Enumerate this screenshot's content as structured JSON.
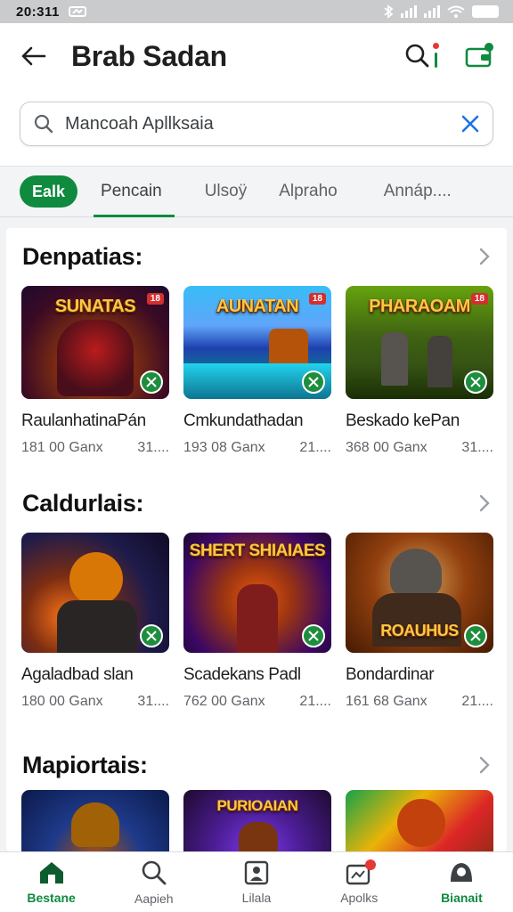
{
  "status_bar": {
    "time": "20:311"
  },
  "header": {
    "title": "Brab Sadan",
    "back_icon": "arrow-left-icon",
    "search_icon": "search-icon",
    "notification_icon": "wallet-icon"
  },
  "search": {
    "value": "Mancoah Apllksaia",
    "placeholder": "Mancoah Apllksaia"
  },
  "tabs": [
    {
      "label": "Ealk",
      "active": true
    },
    {
      "label": "Pencain",
      "active": false
    },
    {
      "label": "Ulsoÿ",
      "active": false
    },
    {
      "label": "Alpraho",
      "active": false
    },
    {
      "label": "Annáp....",
      "active": false
    }
  ],
  "sections": [
    {
      "title": "Denpatias:",
      "apps": [
        {
          "name": "RaulanhatinaPán",
          "downloads": "181 00 Ganx",
          "size": "31....",
          "thumb_text": "SUNATAS",
          "badge": "18"
        },
        {
          "name": "Cmkundathadan",
          "downloads": "193 08 Ganx",
          "size": "21....",
          "thumb_text": "AUNATAN",
          "badge": "18"
        },
        {
          "name": "Beskado kePan",
          "downloads": "368 00 Ganx",
          "size": "31....",
          "thumb_text": "PHARAOAM",
          "badge": "18"
        }
      ]
    },
    {
      "title": "Caldurlais:",
      "apps": [
        {
          "name": "Agaladbad slan",
          "downloads": "180 00 Ganx",
          "size": "31....",
          "thumb_text": "",
          "badge": ""
        },
        {
          "name": "Scadekans Padl",
          "downloads": "762 00 Ganx",
          "size": "21....",
          "thumb_text": "SHERT SHIAIAES",
          "badge": ""
        },
        {
          "name": "Bondardinar",
          "downloads": "161 68 Ganx",
          "size": "21....",
          "thumb_text": "ROAUHUS",
          "badge": ""
        }
      ]
    },
    {
      "title": "Mapiortais:",
      "apps": [
        {
          "thumb_text": ""
        },
        {
          "thumb_text": "PURIOAIAN"
        },
        {
          "thumb_text": ""
        }
      ]
    }
  ],
  "bottom_nav": [
    {
      "label": "Bestane",
      "icon": "home-icon",
      "active": true
    },
    {
      "label": "Aapieh",
      "icon": "search-icon",
      "active": false
    },
    {
      "label": "Lilala",
      "icon": "gallery-icon",
      "active": false
    },
    {
      "label": "Apolks",
      "icon": "apps-icon",
      "active": false
    },
    {
      "label": "Bianait",
      "icon": "account-icon",
      "active": false
    }
  ],
  "colors": {
    "accent": "#0f8a3f",
    "badge_red": "#e53935"
  }
}
